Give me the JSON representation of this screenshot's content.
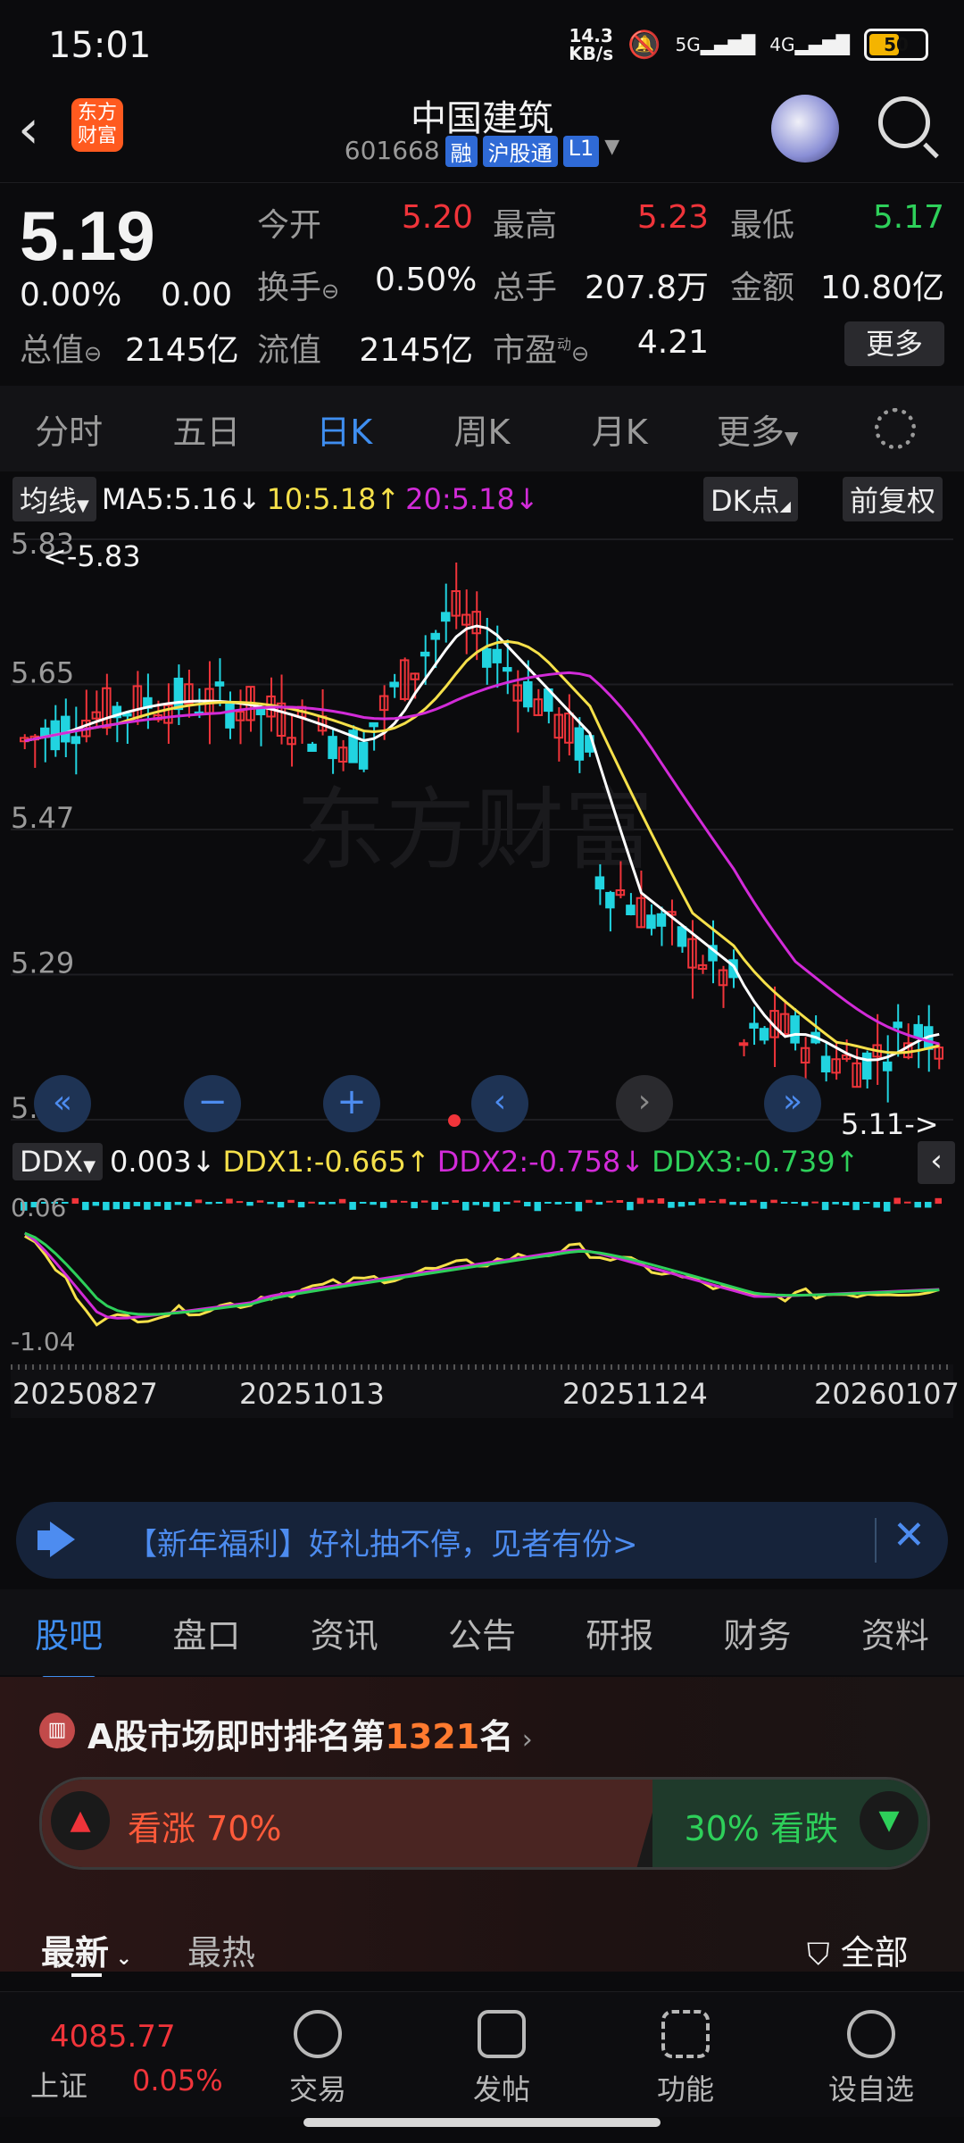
{
  "status_bar": {
    "time": "15:01",
    "net_speed_top": "14.3",
    "net_speed_bottom": "KB/s",
    "sig1": "5G",
    "sig2": "4G",
    "battery": "50"
  },
  "header": {
    "logo_line1": "东方",
    "logo_line2": "财富",
    "stock_name": "中国建筑",
    "stock_code": "601668",
    "tag1": "融",
    "tag2": "沪股通",
    "tag3": "L1"
  },
  "quote": {
    "price": "5.19",
    "change_pct": "0.00%",
    "change_val": "0.00",
    "open_label": "今开",
    "open": "5.20",
    "high_label": "最高",
    "high": "5.23",
    "low_label": "最低",
    "low": "5.17",
    "turnover_label": "换手",
    "turnover": "0.50%",
    "volume_label": "总手",
    "volume": "207.8万",
    "amount_label": "金额",
    "amount": "10.80亿",
    "mktcap_label": "总值",
    "mktcap": "2145亿",
    "float_label": "流值",
    "float_cap": "2145亿",
    "pe_label": "市盈",
    "pe_sup": "动",
    "pe": "4.21",
    "more": "更多"
  },
  "period_tabs": [
    "分时",
    "五日",
    "日K",
    "周K",
    "月K",
    "更多"
  ],
  "chart": {
    "ma_button": "均线",
    "ma5": "MA5:5.16",
    "ma5_arrow": "↓",
    "ma10": "10:5.18",
    "ma10_arrow": "↑",
    "ma20": "20:5.18",
    "ma20_arrow": "↓",
    "dk_button": "DK点",
    "adjust_button": "前复权",
    "y_ticks": [
      "5.83",
      "5.65",
      "5.47",
      "5.29",
      "5.11"
    ],
    "max_marker": "<-5.83",
    "min_marker": "5.11->",
    "watermark": "东方财富",
    "ind_button": "DDX",
    "ddx": "0.003",
    "ddx_arrow": "↓",
    "ddx1": "DDX1:-0.665",
    "ddx1_arrow": "↑",
    "ddx2": "DDX2:-0.758",
    "ddx2_arrow": "↓",
    "ddx3": "DDX3:-0.739",
    "ddx3_arrow": "↑",
    "ind_y_top": "0.06",
    "ind_y_bottom": "-1.04",
    "dates": [
      "20250827",
      "20251013",
      "20251124",
      "20260107"
    ],
    "colors": {
      "up": "#f0343a",
      "down": "#21d4e0",
      "ma5": "#ffffff",
      "ma10": "#f5e04a",
      "ma20": "#d22bd8",
      "ddx3": "#2ed05a"
    }
  },
  "notice": {
    "text": "【新年福利】好礼抽不停，见者有份>"
  },
  "info_tabs": [
    "股吧",
    "盘口",
    "资讯",
    "公告",
    "研报",
    "财务",
    "资料"
  ],
  "rank": {
    "prefix": "A股市场即时排名第",
    "number": "1321",
    "suffix": "名"
  },
  "sentiment": {
    "bull": "看涨 70%",
    "bear": "30% 看跌",
    "bull_fraction": 0.7
  },
  "feed": {
    "latest": "最新",
    "hot": "最热",
    "filter": "全部"
  },
  "nav": {
    "index_value": "4085.77",
    "index_name": "上证",
    "index_change": "0.05%",
    "trade": "交易",
    "post": "发帖",
    "func": "功能",
    "watch": "设自选"
  }
}
